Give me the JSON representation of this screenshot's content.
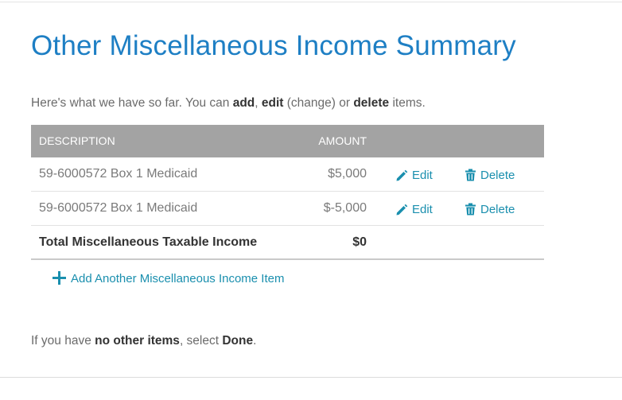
{
  "title": "Other Miscellaneous Income Summary",
  "intro": {
    "part1": "Here's what we have so far. You can ",
    "add": "add",
    "sep1": ", ",
    "edit": "edit",
    "part2": " (change) or ",
    "delete": "delete",
    "part3": " items."
  },
  "table": {
    "headers": {
      "description": "DESCRIPTION",
      "amount": "AMOUNT"
    },
    "rows": [
      {
        "description": "59-6000572 Box 1 Medicaid",
        "amount": "$5,000",
        "edit_label": "Edit",
        "delete_label": "Delete"
      },
      {
        "description": "59-6000572 Box 1 Medicaid",
        "amount": "$-5,000",
        "edit_label": "Edit",
        "delete_label": "Delete"
      }
    ],
    "total": {
      "label": "Total Miscellaneous Taxable Income",
      "amount": "$0"
    }
  },
  "add_link": {
    "label": "Add Another Miscellaneous Income Item"
  },
  "footer": {
    "part1": "If you have ",
    "no_other_items": "no other items",
    "part2": ", select ",
    "done": "Done",
    "part3": "."
  },
  "colors": {
    "title": "#1e7fc4",
    "link": "#1a8fae",
    "header_bg": "#a3a3a3"
  },
  "icons": {
    "edit": "pencil-icon",
    "delete": "trash-icon",
    "add": "plus-icon"
  }
}
